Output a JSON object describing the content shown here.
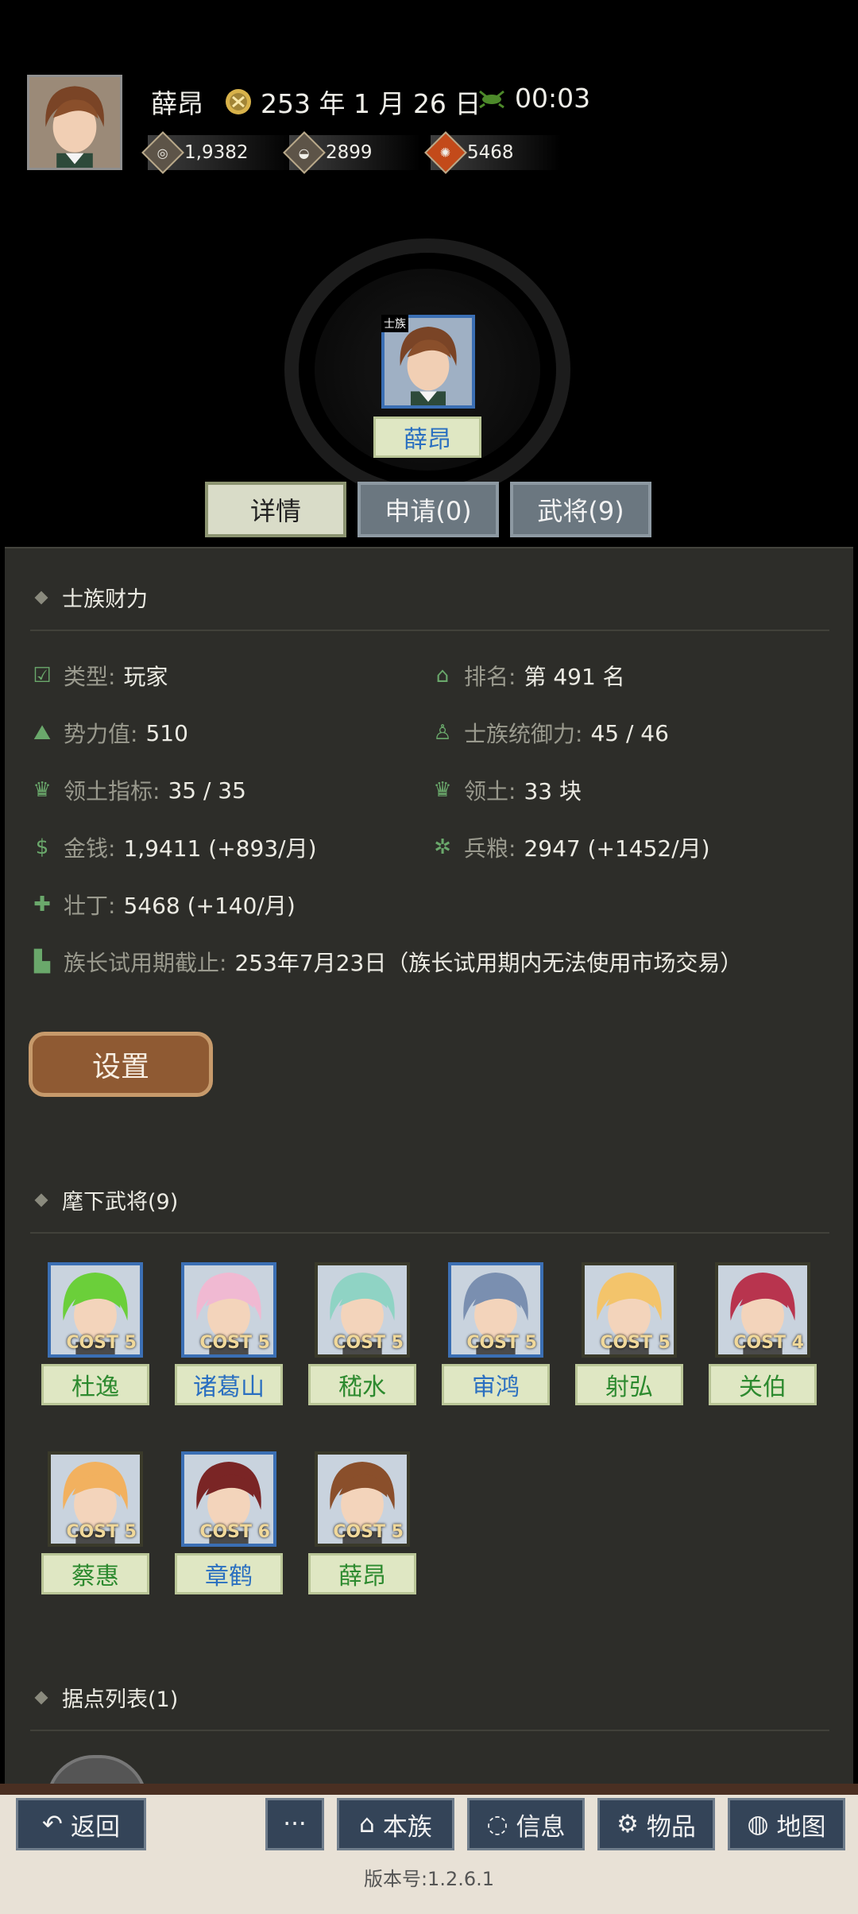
{
  "header": {
    "player_name": "薛昂",
    "date": "253 年 1 月 26 日",
    "time": "00:03",
    "resources": [
      {
        "icon": "silver-coin-icon",
        "value": "1,9382"
      },
      {
        "icon": "grain-bowl-icon",
        "value": "2899"
      },
      {
        "icon": "manpower-icon",
        "value": "5468"
      }
    ]
  },
  "clan_card": {
    "badge": "士族",
    "name": "薛昂"
  },
  "tabs": [
    {
      "label": "详情",
      "active": true
    },
    {
      "label": "申请(0)",
      "active": false
    },
    {
      "label": "武将(9)",
      "active": false
    }
  ],
  "wealth": {
    "title": "士族财力",
    "rows": [
      {
        "label": "类型:",
        "value": "玩家",
        "icon": "calendar-check-icon"
      },
      {
        "label": "排名:",
        "value": "第 491 名",
        "icon": "rank-icon"
      },
      {
        "label": "势力值:",
        "value": "510",
        "icon": "mountain-icon"
      },
      {
        "label": "士族统御力:",
        "value": "45 / 46",
        "icon": "person-icon"
      },
      {
        "label": "领土指标:",
        "value": "35 / 35",
        "icon": "territory-icon"
      },
      {
        "label": "领土:",
        "value": "33 块",
        "icon": "territory-icon"
      },
      {
        "label": "金钱:",
        "value": "1,9411 (+893/月)",
        "icon": "money-icon"
      },
      {
        "label": "兵粮:",
        "value": "2947 (+1452/月)",
        "icon": "grain-icon"
      },
      {
        "label": "壮丁:",
        "value": "5468 (+140/月)",
        "icon": "strongman-icon"
      },
      {
        "label": "族长试用期截止:",
        "value": "253年7月23日（族长试用期内无法使用市场交易）",
        "icon": "boot-icon"
      }
    ],
    "settings_label": "设置"
  },
  "generals": {
    "title": "麾下武将(9)",
    "cost_prefix": "COST",
    "items": [
      {
        "name": "杜逸",
        "cost": "5",
        "hair": "#6bcf3a",
        "frame": "#3b6fb4"
      },
      {
        "name": "诸葛山",
        "cost": "5",
        "hair": "#f0b9d2",
        "frame": "#3b6fb4"
      },
      {
        "name": "嵇水",
        "cost": "5",
        "hair": "#8fd3c4",
        "frame": "#3a3a2a"
      },
      {
        "name": "审鸿",
        "cost": "5",
        "hair": "#7a8fb0",
        "frame": "#3b6fb4"
      },
      {
        "name": "射弘",
        "cost": "5",
        "hair": "#f3c46b",
        "frame": "#3a3a2a"
      },
      {
        "name": "关伯",
        "cost": "4",
        "hair": "#b8344e",
        "frame": "#3a3a2a"
      },
      {
        "name": "蔡惠",
        "cost": "5",
        "hair": "#f2b15f",
        "frame": "#3a3a2a"
      },
      {
        "name": "章鹤",
        "cost": "6",
        "hair": "#7a2525",
        "frame": "#3b6fb4"
      },
      {
        "name": "薛昂",
        "cost": "5",
        "hair": "#8a4f2b",
        "frame": "#3a3a2a"
      }
    ]
  },
  "strongholds": {
    "title": "据点列表(1)"
  },
  "bottom_nav": {
    "back": "返回",
    "more": "···",
    "clan": "本族",
    "info": "信息",
    "items": "物品",
    "map": "地图",
    "version": "版本号:1.2.6.1"
  }
}
